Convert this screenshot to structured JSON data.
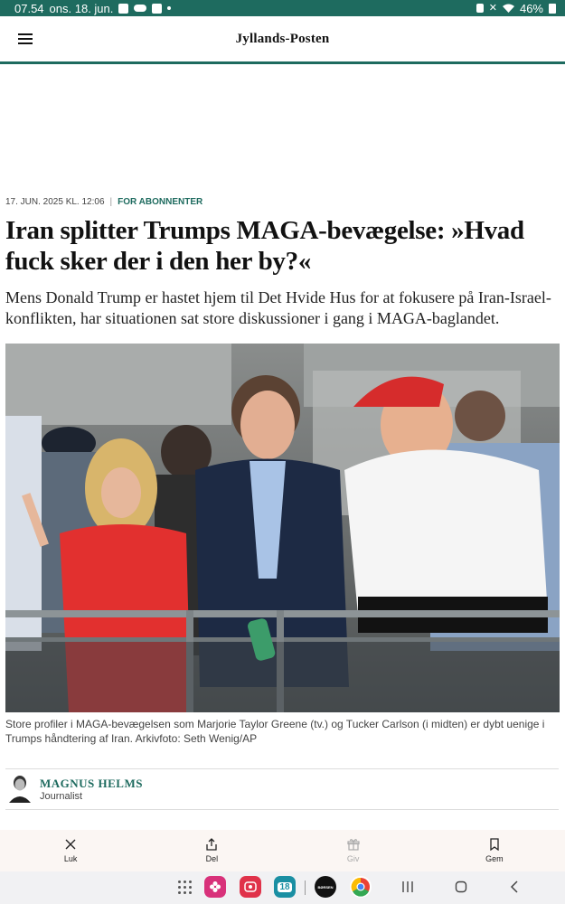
{
  "status_bar": {
    "time": "07.54",
    "date": "ons. 18. jun.",
    "battery": "46%"
  },
  "header": {
    "logo": "Jyllands-Posten"
  },
  "article": {
    "date": "17. JUN. 2025 KL. 12:06",
    "separator": "|",
    "tag": "FOR ABONNENTER",
    "headline": "Iran splitter Trumps MAGA-bevægelse: »Hvad fuck sker der i den her by?«",
    "lead": "Mens Donald Trump er hastet hjem til Det Hvide Hus for at fokusere på Iran-Israel-konflikten, har situationen sat store diskussioner i gang i MAGA-baglandet.",
    "caption": "Store profiler i MAGA-bevægelsen som Marjorie Taylor Greene (tv.) og Tucker Carlson (i midten) er dybt uenige i Trumps håndtering af Iran. Arkivfoto: Seth Wenig/AP"
  },
  "author": {
    "name": "MAGNUS HELMS",
    "role": "Journalist"
  },
  "actions": [
    {
      "label": "Luk",
      "icon": "close-icon"
    },
    {
      "label": "Del",
      "icon": "share-icon"
    },
    {
      "label": "Giv",
      "icon": "gift-icon"
    },
    {
      "label": "Gem",
      "icon": "bookmark-icon"
    }
  ],
  "dock": {
    "calendar_day": "18",
    "borsen_label": "BØRSEN"
  },
  "colors": {
    "brand": "#1e6b5f",
    "action_bar_bg": "#fbf6f3"
  }
}
